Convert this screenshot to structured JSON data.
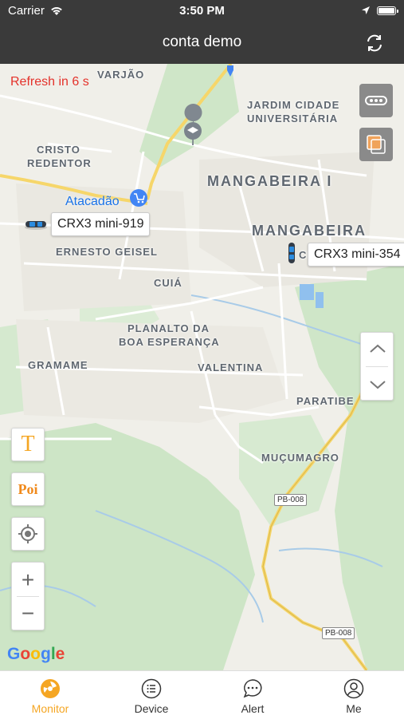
{
  "status_bar": {
    "carrier": "Carrier",
    "time": "3:50 PM"
  },
  "nav": {
    "title": "conta demo",
    "refresh_icon": "refresh-icon"
  },
  "map": {
    "refresh_text": "Refresh in 6 s",
    "places": {
      "varjao": "VARJÃO",
      "jardim_1": "JARDIM CIDADE",
      "jardim_2": "UNIVERSITÁRIA",
      "cristo_1": "CRISTO",
      "cristo_2": "REDENTOR",
      "mangabeira_i": "MANGABEIRA I",
      "mangabeira": "MANGABEIRA",
      "ernesto": "ERNESTO GEISEL",
      "cuia": "CUIÁ",
      "planalto_1": "PLANALTO DA",
      "planalto_2": "BOA ESPERANÇA",
      "gramame": "GRAMAME",
      "valentina": "VALENTINA",
      "paratibe": "PARATIBE",
      "mucumagro": "MUÇUMAGRO",
      "cid": "CID"
    },
    "shop": "Atacadão",
    "devices": [
      {
        "name": "CRX3 mini-919"
      },
      {
        "name": "CRX3 mini-354"
      }
    ],
    "road_tags": [
      "PB-008",
      "PB-008"
    ],
    "google": [
      "G",
      "o",
      "o",
      "g",
      "l",
      "e"
    ],
    "controls": {
      "text_button": "T",
      "poi_button": "Poi",
      "zoom_in": "+",
      "zoom_out": "−"
    }
  },
  "tabs": [
    {
      "label": "Monitor",
      "icon": "monitor-icon",
      "active": true
    },
    {
      "label": "Device",
      "icon": "device-list-icon",
      "active": false
    },
    {
      "label": "Alert",
      "icon": "alert-chat-icon",
      "active": false
    },
    {
      "label": "Me",
      "icon": "profile-icon",
      "active": false
    }
  ],
  "colors": {
    "accent": "#f5a623",
    "header": "#3a3a3a",
    "refresh_text": "#e4322b",
    "shop_blue": "#1a73e8"
  }
}
